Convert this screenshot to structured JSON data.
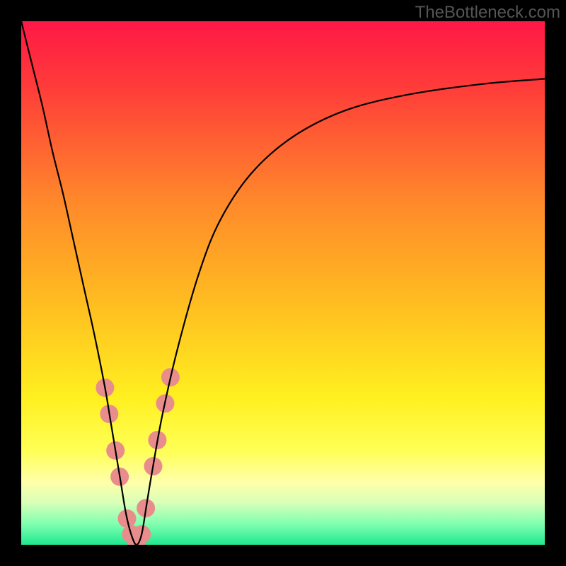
{
  "watermark": "TheBottleneck.com",
  "chart_data": {
    "type": "line",
    "title": "",
    "xlabel": "",
    "ylabel": "",
    "xlim": [
      0,
      100
    ],
    "ylim": [
      0,
      100
    ],
    "background_gradient": {
      "stops": [
        {
          "offset": 0.0,
          "color": "#ff1846"
        },
        {
          "offset": 0.12,
          "color": "#ff3a3a"
        },
        {
          "offset": 0.35,
          "color": "#ff8a2a"
        },
        {
          "offset": 0.55,
          "color": "#ffc020"
        },
        {
          "offset": 0.72,
          "color": "#fff020"
        },
        {
          "offset": 0.82,
          "color": "#ffff55"
        },
        {
          "offset": 0.88,
          "color": "#ffffaa"
        },
        {
          "offset": 0.92,
          "color": "#d8ffb8"
        },
        {
          "offset": 0.96,
          "color": "#80ffb0"
        },
        {
          "offset": 1.0,
          "color": "#20e890"
        }
      ]
    },
    "series": [
      {
        "name": "bottleneck-curve",
        "color": "#000000",
        "x": [
          0,
          2,
          4,
          6,
          8,
          10,
          12,
          14,
          16,
          17,
          18,
          19,
          20,
          21,
          22,
          23,
          24,
          25,
          27,
          30,
          34,
          38,
          44,
          52,
          62,
          74,
          88,
          100
        ],
        "y": [
          100,
          92,
          84,
          75,
          67,
          58,
          49,
          40,
          30,
          24,
          18,
          12,
          6,
          2,
          0,
          2,
          8,
          14,
          25,
          38,
          52,
          62,
          71,
          78,
          83,
          86,
          88,
          89
        ]
      }
    ],
    "markers": {
      "name": "highlight-points",
      "color": "#e98c8c",
      "radius_px": 13,
      "points": [
        {
          "x": 16.0,
          "y": 30
        },
        {
          "x": 16.8,
          "y": 25
        },
        {
          "x": 18.0,
          "y": 18
        },
        {
          "x": 18.8,
          "y": 13
        },
        {
          "x": 20.2,
          "y": 5
        },
        {
          "x": 21.0,
          "y": 2
        },
        {
          "x": 22.0,
          "y": 0
        },
        {
          "x": 23.0,
          "y": 2
        },
        {
          "x": 23.8,
          "y": 7
        },
        {
          "x": 25.2,
          "y": 15
        },
        {
          "x": 26.0,
          "y": 20
        },
        {
          "x": 27.5,
          "y": 27
        },
        {
          "x": 28.5,
          "y": 32
        }
      ]
    },
    "minimum": {
      "x": 22,
      "y": 0
    }
  }
}
